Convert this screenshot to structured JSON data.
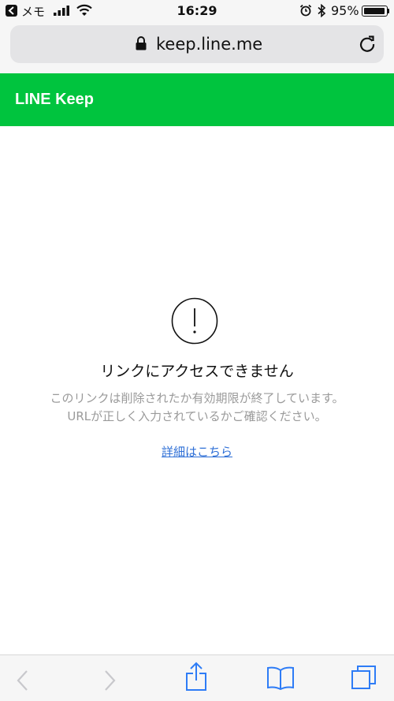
{
  "status_bar": {
    "back_app": "メモ",
    "time": "16:29",
    "battery_pct": "95%",
    "battery_level": 0.95
  },
  "url_bar": {
    "url": "keep.line.me"
  },
  "header": {
    "title": "LINE Keep",
    "color": "#00c43e"
  },
  "error": {
    "title": "リンクにアクセスできません",
    "line1": "このリンクは削除されたか有効期限が終了しています。",
    "line2": "URLが正しく入力されているかご確認ください。",
    "details_link": "詳細はこちら"
  },
  "toolbar": {
    "items": [
      "back-icon",
      "forward-icon",
      "share-icon",
      "bookmarks-icon",
      "tabs-icon"
    ],
    "accent": "#2e7cf6"
  }
}
